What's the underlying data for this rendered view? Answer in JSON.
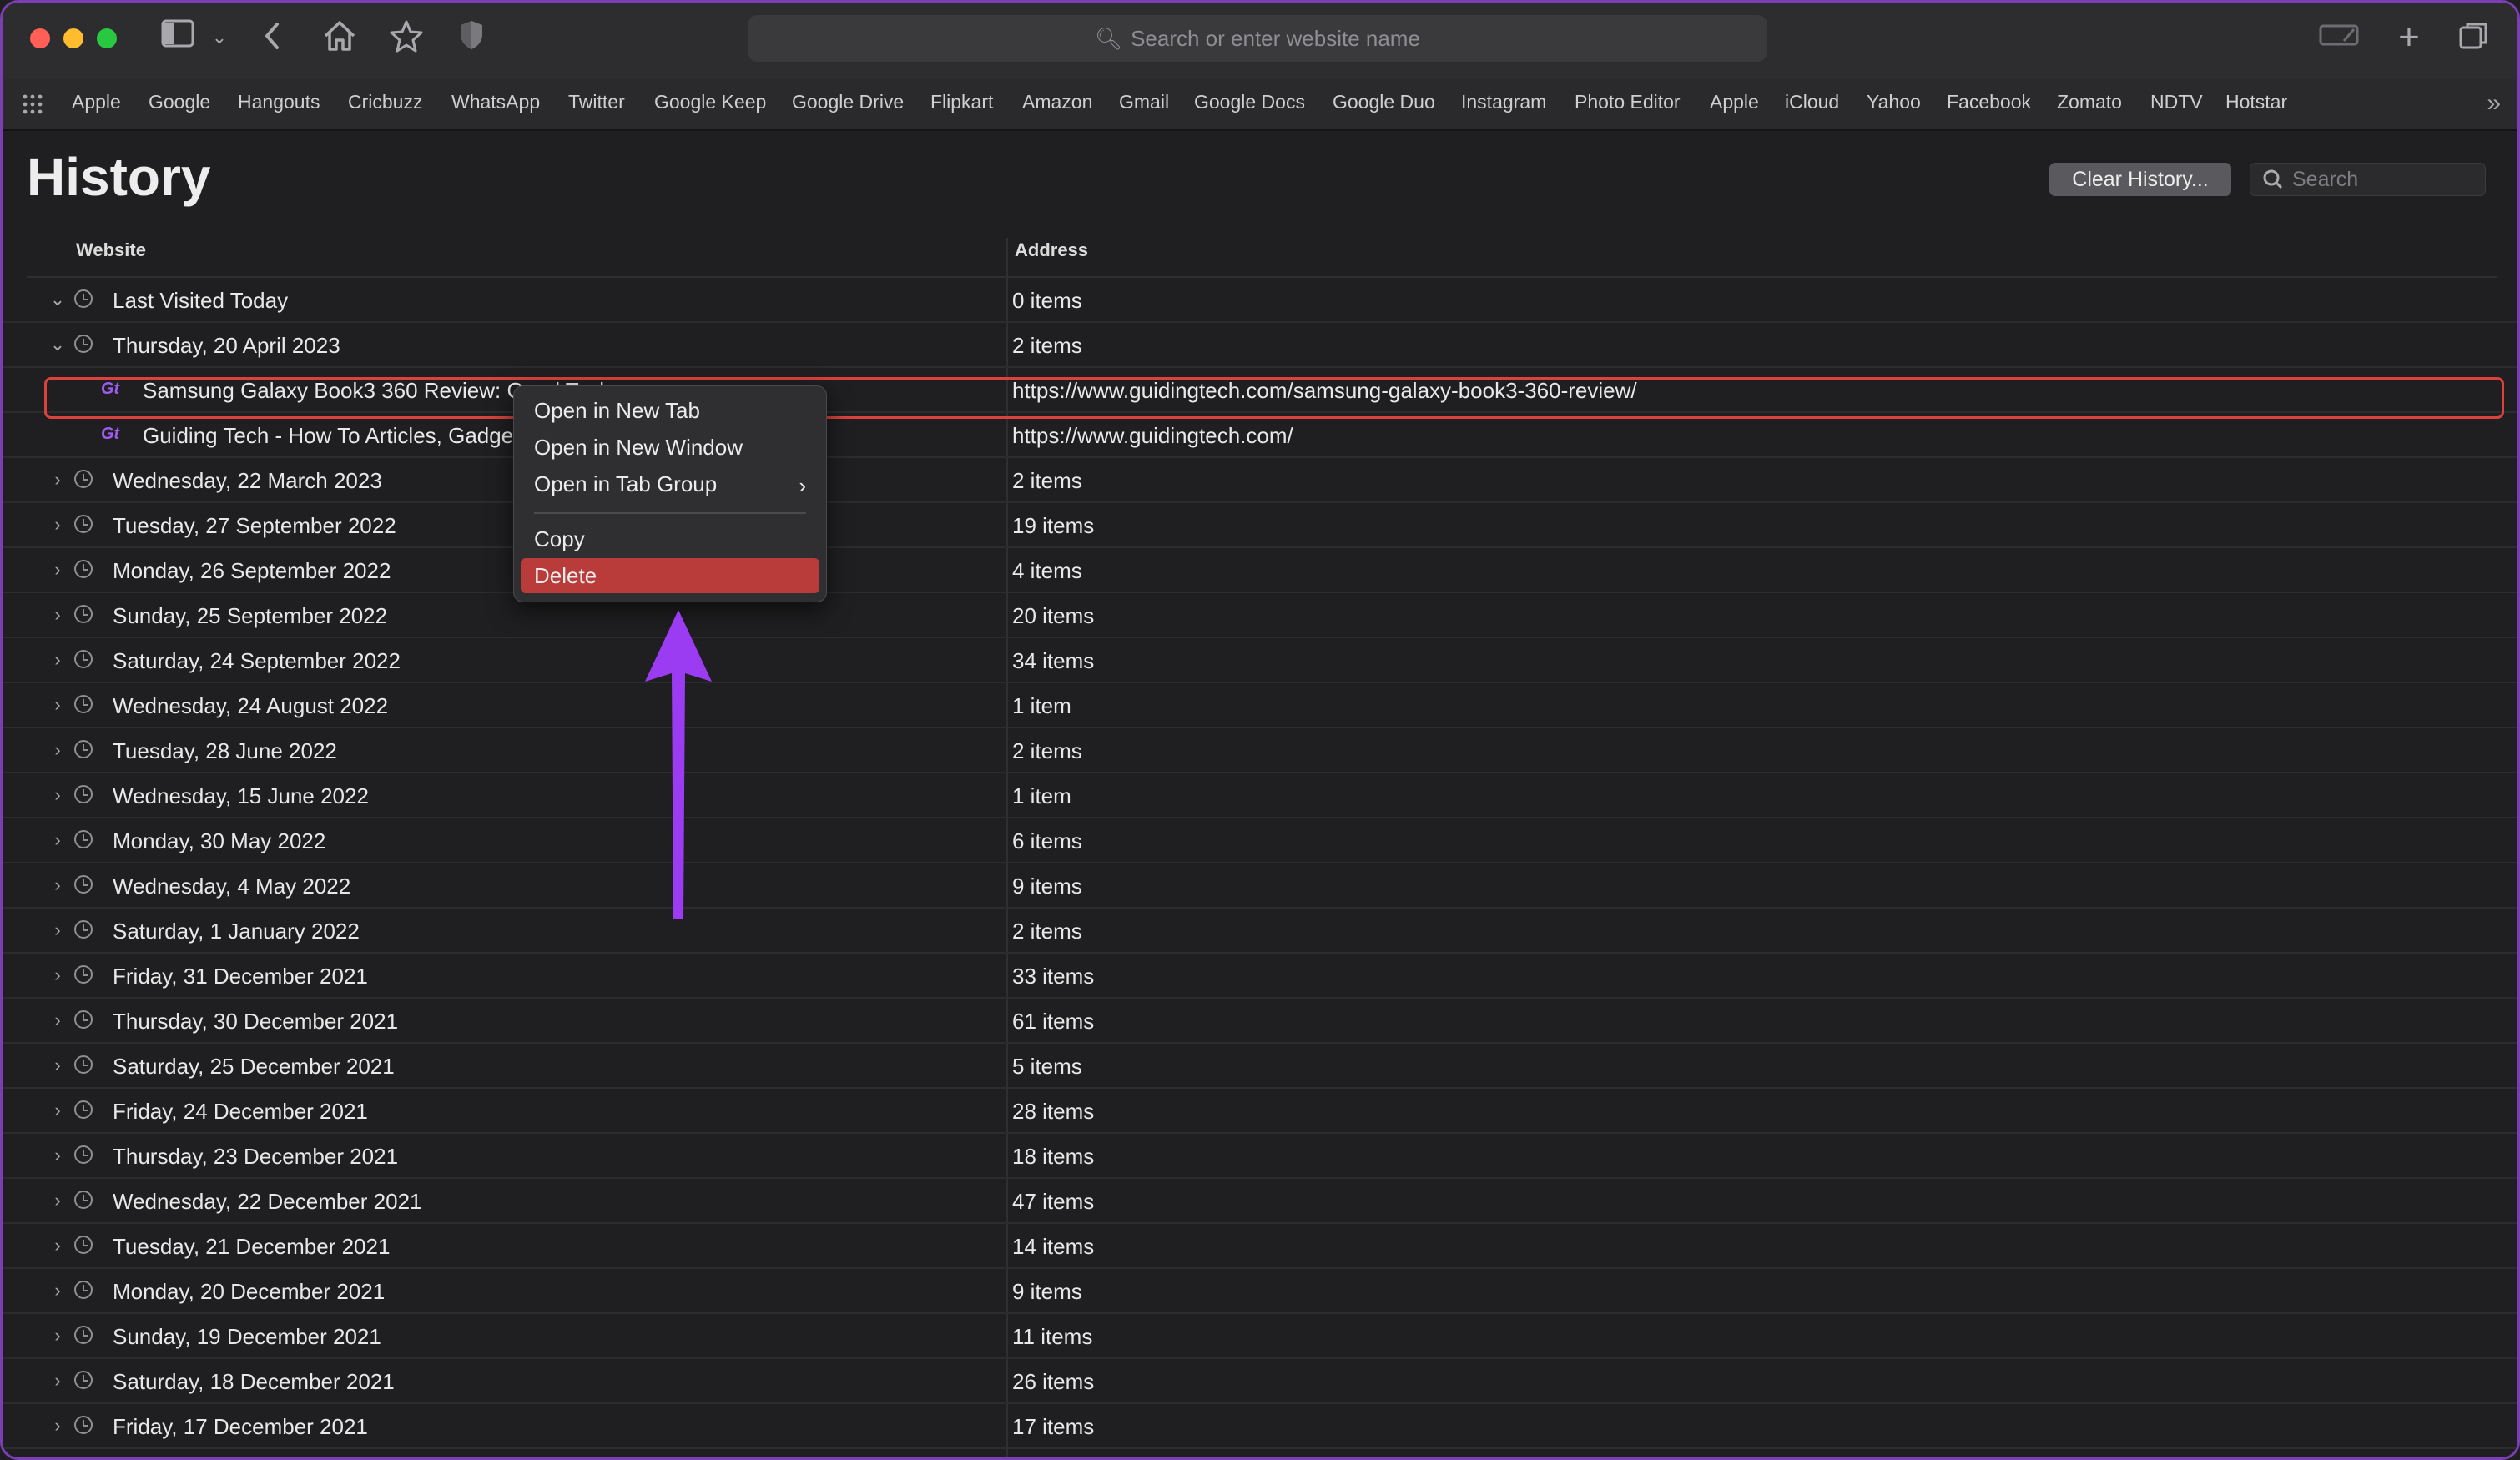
{
  "toolbar": {
    "address_placeholder": "Search or enter website name"
  },
  "favorites": [
    "Apple",
    "Google",
    "Hangouts",
    "Cricbuzz",
    "WhatsApp",
    "Twitter",
    "Google Keep",
    "Google Drive",
    "Flipkart",
    "Amazon",
    "Gmail",
    "Google Docs",
    "Google Duo",
    "Instagram",
    "Photo Editor",
    "Apple",
    "iCloud",
    "Yahoo",
    "Facebook",
    "Zomato",
    "NDTV",
    "Hotstar"
  ],
  "header": {
    "title": "History",
    "clear_button": "Clear History...",
    "search_placeholder": "Search"
  },
  "columns": {
    "website": "Website",
    "address": "Address"
  },
  "rows": [
    {
      "label": "Last Visited Today",
      "address": "0 items",
      "expanded": true
    },
    {
      "label": "Thursday, 20 April 2023",
      "address": "2 items",
      "expanded": true
    },
    {
      "label": "Samsung Galaxy Book3 360 Review: Good Tech",
      "address": "https://www.guidingtech.com/samsung-galaxy-book3-360-review/",
      "child": true,
      "selected": true,
      "favicon": "Gt"
    },
    {
      "label": "Guiding Tech - How To Articles, Gadgets",
      "address": "https://www.guidingtech.com/",
      "child": true,
      "favicon": "Gt"
    },
    {
      "label": "Wednesday, 22 March 2023",
      "address": "2 items"
    },
    {
      "label": "Tuesday, 27 September 2022",
      "address": "19 items"
    },
    {
      "label": "Monday, 26 September 2022",
      "address": "4 items"
    },
    {
      "label": "Sunday, 25 September 2022",
      "address": "20 items"
    },
    {
      "label": "Saturday, 24 September 2022",
      "address": "34 items"
    },
    {
      "label": "Wednesday, 24 August 2022",
      "address": "1 item"
    },
    {
      "label": "Tuesday, 28 June 2022",
      "address": "2 items"
    },
    {
      "label": "Wednesday, 15 June 2022",
      "address": "1 item"
    },
    {
      "label": "Monday, 30 May 2022",
      "address": "6 items"
    },
    {
      "label": "Wednesday, 4 May 2022",
      "address": "9 items"
    },
    {
      "label": "Saturday, 1 January 2022",
      "address": "2 items"
    },
    {
      "label": "Friday, 31 December 2021",
      "address": "33 items"
    },
    {
      "label": "Thursday, 30 December 2021",
      "address": "61 items"
    },
    {
      "label": "Saturday, 25 December 2021",
      "address": "5 items"
    },
    {
      "label": "Friday, 24 December 2021",
      "address": "28 items"
    },
    {
      "label": "Thursday, 23 December 2021",
      "address": "18 items"
    },
    {
      "label": "Wednesday, 22 December 2021",
      "address": "47 items"
    },
    {
      "label": "Tuesday, 21 December 2021",
      "address": "14 items"
    },
    {
      "label": "Monday, 20 December 2021",
      "address": "9 items"
    },
    {
      "label": "Sunday, 19 December 2021",
      "address": "11 items"
    },
    {
      "label": "Saturday, 18 December 2021",
      "address": "26 items"
    },
    {
      "label": "Friday, 17 December 2021",
      "address": "17 items"
    }
  ],
  "context_menu": {
    "items": [
      "Open in New Tab",
      "Open in New Window",
      "Open in Tab Group",
      "Copy",
      "Delete"
    ],
    "highlighted": "Delete"
  },
  "annotation": {
    "arrow_color": "#9b3cf2"
  }
}
